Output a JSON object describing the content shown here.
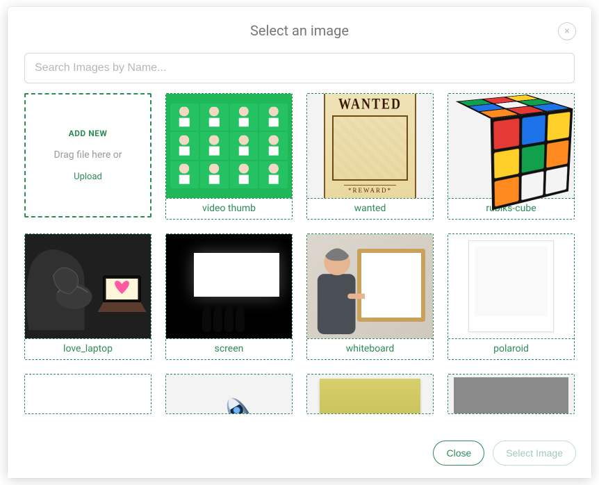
{
  "modal": {
    "title": "Select an image",
    "close_label": "×"
  },
  "search": {
    "placeholder": "Search Images by Name...",
    "value": ""
  },
  "upload": {
    "heading": "ADD NEW",
    "drag_text": "Drag file here or",
    "upload_text": "Upload"
  },
  "wanted_card": {
    "headline": "WANTED",
    "footer": "*REWARD*"
  },
  "images": [
    {
      "name": "video thumb"
    },
    {
      "name": "wanted"
    },
    {
      "name": "rubiks-cube"
    },
    {
      "name": "love_laptop"
    },
    {
      "name": "screen"
    },
    {
      "name": "whiteboard"
    },
    {
      "name": "polaroid"
    }
  ],
  "buttons": {
    "close": "Close",
    "select": "Select Image"
  }
}
